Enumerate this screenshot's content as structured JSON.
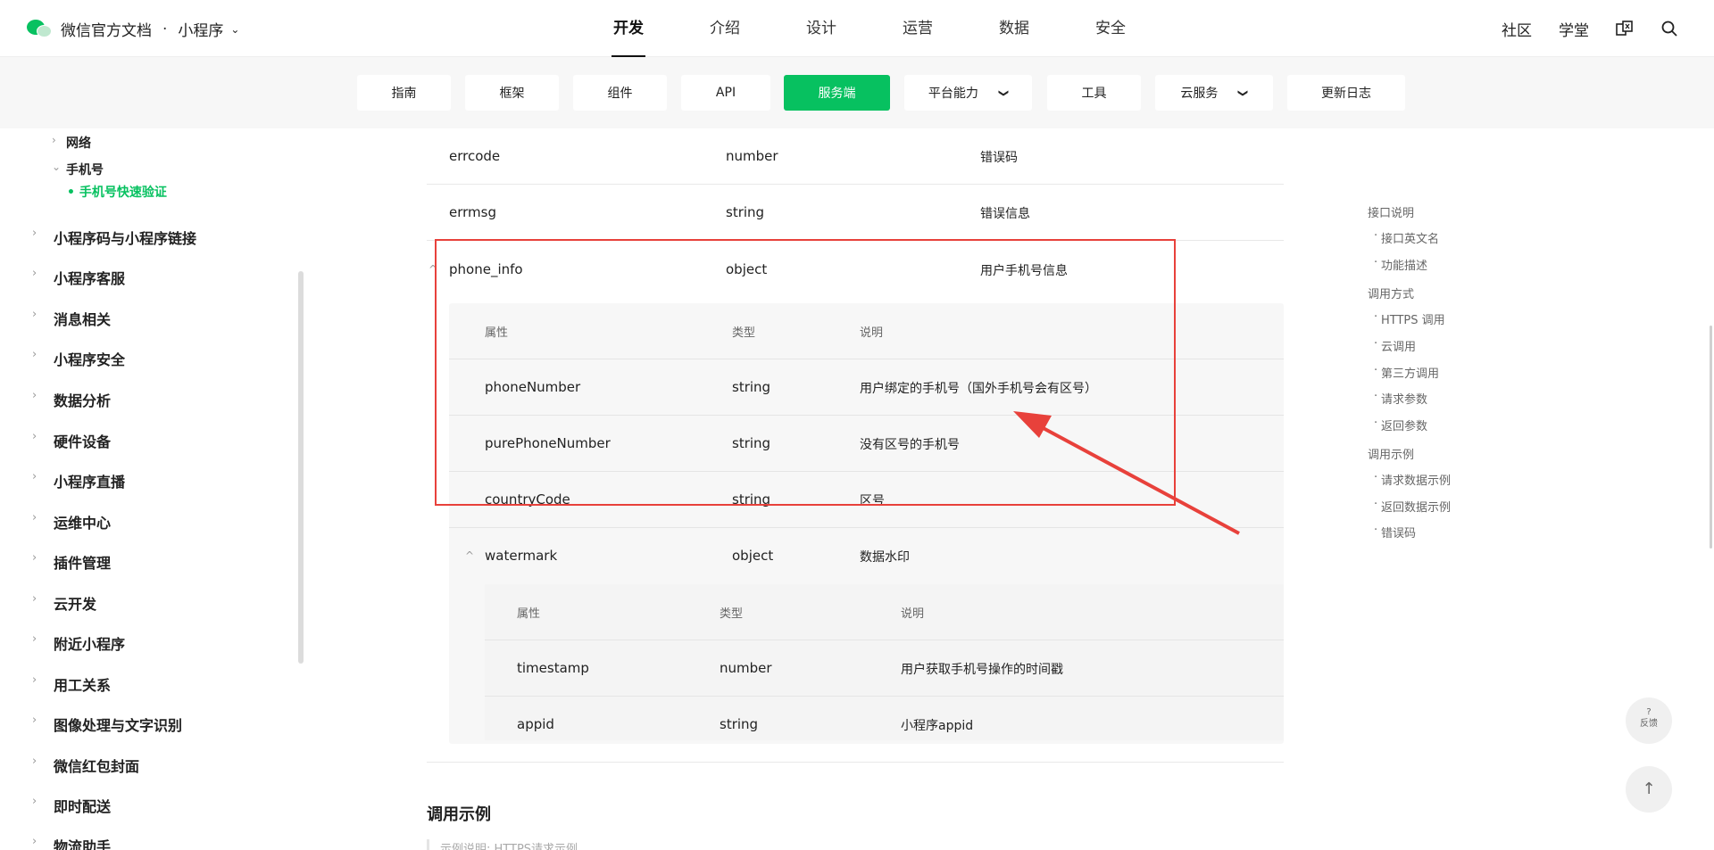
{
  "brand": {
    "title": "微信官方文档",
    "section": "小程序",
    "chevron": "⌄"
  },
  "topnav": [
    "开发",
    "介绍",
    "设计",
    "运营",
    "数据",
    "安全"
  ],
  "topright": {
    "community": "社区",
    "academy": "学堂"
  },
  "subnav": [
    {
      "label": "指南",
      "active": false,
      "dropdown": false
    },
    {
      "label": "框架",
      "active": false,
      "dropdown": false
    },
    {
      "label": "组件",
      "active": false,
      "dropdown": false
    },
    {
      "label": "API",
      "active": false,
      "dropdown": false
    },
    {
      "label": "服务端",
      "active": true,
      "dropdown": false
    },
    {
      "label": "平台能力",
      "active": false,
      "dropdown": true
    },
    {
      "label": "工具",
      "active": false,
      "dropdown": false
    },
    {
      "label": "云服务",
      "active": false,
      "dropdown": true
    },
    {
      "label": "更新日志",
      "active": false,
      "dropdown": false
    }
  ],
  "sidebar": {
    "network": "网络",
    "phone": "手机号",
    "phone_active": "• 手机号快速验证",
    "items": [
      "小程序码与小程序链接",
      "小程序客服",
      "消息相关",
      "小程序安全",
      "数据分析",
      "硬件设备",
      "小程序直播",
      "运维中心",
      "插件管理",
      "云开发",
      "附近小程序",
      "用工关系",
      "图像处理与文字识别",
      "微信红包封面",
      "即时配送",
      "物流助手"
    ]
  },
  "table": {
    "rows": [
      {
        "name": "errcode",
        "type": "number",
        "desc": "错误码"
      },
      {
        "name": "errmsg",
        "type": "string",
        "desc": "错误信息"
      },
      {
        "name": "phone_info",
        "type": "object",
        "desc": "用户手机号信息"
      }
    ],
    "phone_header": {
      "name": "属性",
      "type": "类型",
      "desc": "说明"
    },
    "phone_rows": [
      {
        "name": "phoneNumber",
        "type": "string",
        "desc": "用户绑定的手机号（国外手机号会有区号）"
      },
      {
        "name": "purePhoneNumber",
        "type": "string",
        "desc": "没有区号的手机号"
      },
      {
        "name": "countryCode",
        "type": "string",
        "desc": "区号"
      },
      {
        "name": "watermark",
        "type": "object",
        "desc": "数据水印"
      }
    ],
    "watermark_header": {
      "name": "属性",
      "type": "类型",
      "desc": "说明"
    },
    "watermark_rows": [
      {
        "name": "timestamp",
        "type": "number",
        "desc": "用户获取手机号操作的时间戳"
      },
      {
        "name": "appid",
        "type": "string",
        "desc": "小程序appid"
      }
    ]
  },
  "section": {
    "title": "调用示例",
    "note": "示例说明: HTTPS请求示例"
  },
  "toc": [
    {
      "label": "接口说明",
      "level": 1
    },
    {
      "label": "接口英文名",
      "level": 2
    },
    {
      "label": "功能描述",
      "level": 2
    },
    {
      "label": "调用方式",
      "level": 1
    },
    {
      "label": "HTTPS 调用",
      "level": 2
    },
    {
      "label": "云调用",
      "level": 2
    },
    {
      "label": "第三方调用",
      "level": 2
    },
    {
      "label": "请求参数",
      "level": 2
    },
    {
      "label": "返回参数",
      "level": 2
    },
    {
      "label": "调用示例",
      "level": 1
    },
    {
      "label": "请求数据示例",
      "level": 2
    },
    {
      "label": "返回数据示例",
      "level": 2
    },
    {
      "label": "错误码",
      "level": 2
    }
  ],
  "feedback": {
    "icon": "?",
    "label": "反馈"
  },
  "back_to_top": "↑",
  "colors": {
    "accent": "#07c160",
    "highlight": "#e8413b"
  }
}
